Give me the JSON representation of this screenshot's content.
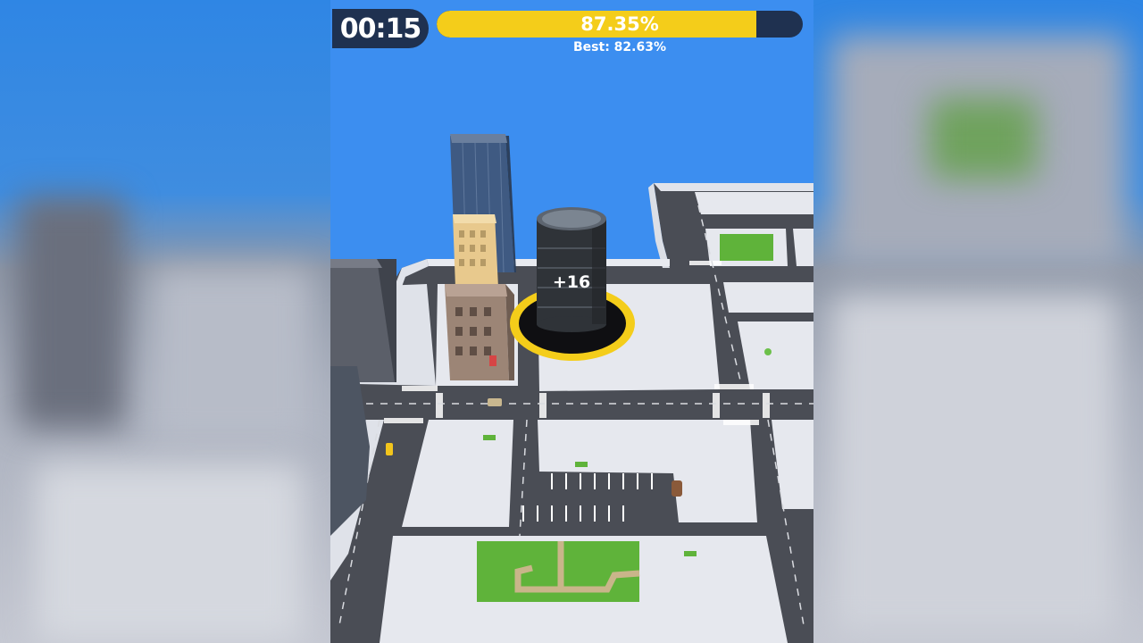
{
  "hud": {
    "timer": "00:15",
    "progress_percent": 87.35,
    "progress_label": "87.35%",
    "best_label": "Best: 82.63%"
  },
  "hole": {
    "score_label": "+16",
    "ring_color": "#f4cd1a"
  },
  "colors": {
    "sky": "#3c8ef0",
    "road": "#4a4d55",
    "block": "#e6e8ee",
    "grass": "#5fb33a",
    "hud_dark": "#1f3150",
    "progress": "#f4cd1a"
  }
}
